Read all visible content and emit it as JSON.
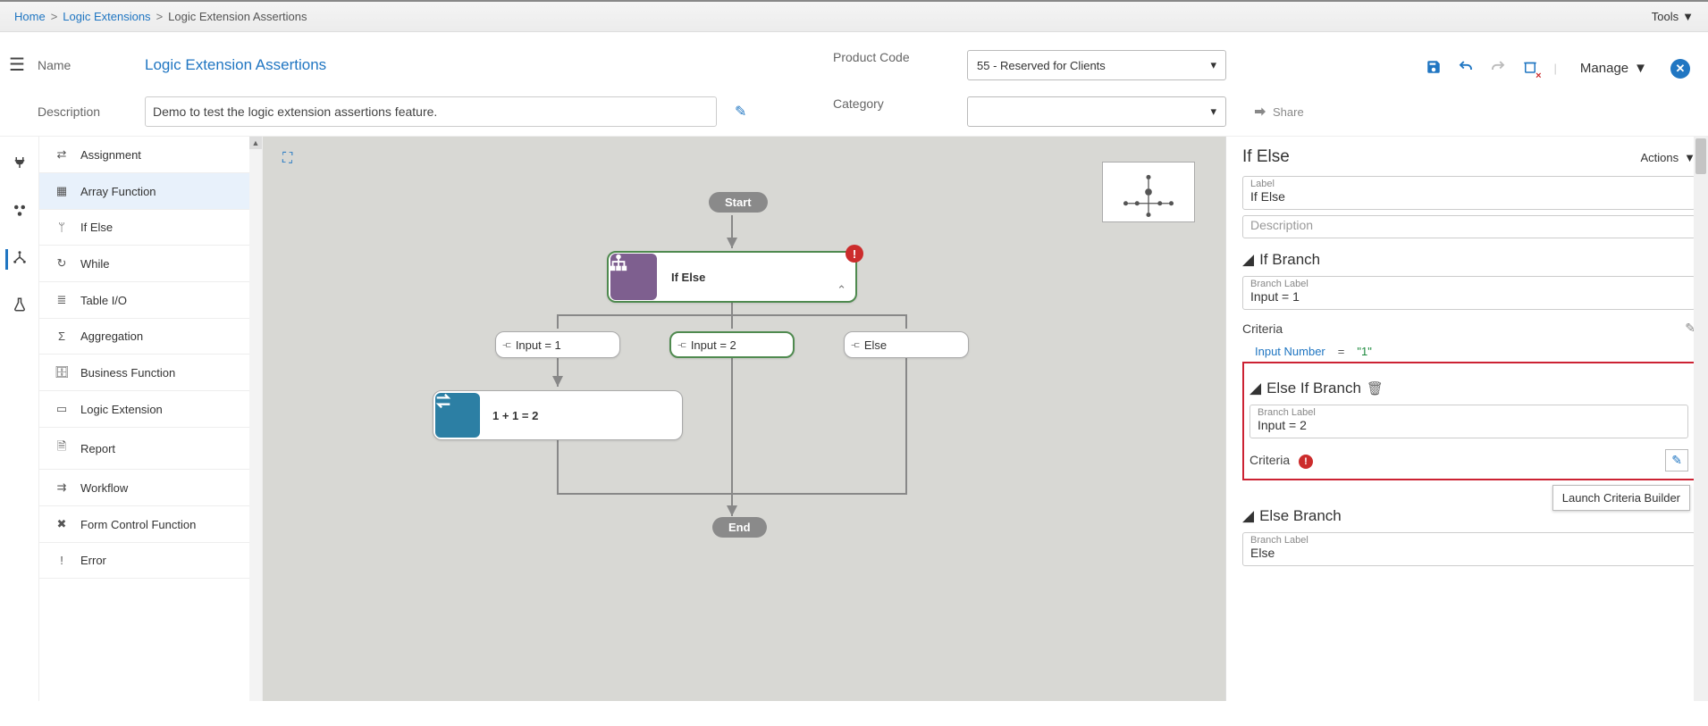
{
  "breadcrumbs": {
    "home": "Home",
    "logic_ext": "Logic Extensions",
    "current": "Logic Extension Assertions"
  },
  "tools_label": "Tools",
  "toolbar": {
    "manage_label": "Manage"
  },
  "form": {
    "name_label": "Name",
    "name_value": "Logic Extension Assertions",
    "desc_label": "Description",
    "desc_value": "Demo to test the logic extension assertions feature.",
    "product_code_label": "Product Code",
    "product_code_value": "55 - Reserved for Clients",
    "category_label": "Category",
    "category_value": "",
    "share_label": "Share"
  },
  "components": [
    {
      "icon": "swap",
      "label": "Assignment"
    },
    {
      "icon": "grid",
      "label": "Array Function",
      "selected": true
    },
    {
      "icon": "tree",
      "label": "If Else"
    },
    {
      "icon": "loop",
      "label": "While"
    },
    {
      "icon": "db",
      "label": "Table I/O"
    },
    {
      "icon": "sigma",
      "label": "Aggregation"
    },
    {
      "icon": "briefcase",
      "label": "Business Function"
    },
    {
      "icon": "wireframe",
      "label": "Logic Extension"
    },
    {
      "icon": "doc",
      "label": "Report"
    },
    {
      "icon": "flow",
      "label": "Workflow"
    },
    {
      "icon": "wrench",
      "label": "Form Control Function"
    },
    {
      "icon": "excl",
      "label": "Error"
    }
  ],
  "canvas": {
    "start": "Start",
    "end": "End",
    "ifelse_label": "If Else",
    "branch1": "Input = 1",
    "branch2": "Input = 2",
    "branch3": "Else",
    "assign1": "1 + 1 = 2"
  },
  "props": {
    "title": "If Else",
    "actions_label": "Actions",
    "label_field": "Label",
    "label_value": "If Else",
    "desc_placeholder": "Description",
    "if_branch_title": "If Branch",
    "branch_label_field": "Branch Label",
    "if_branch_value": "Input = 1",
    "criteria_label": "Criteria",
    "criteria_lhs": "Input Number",
    "criteria_op": "=",
    "criteria_rhs": "\"1\"",
    "elseif_title": "Else If Branch",
    "elseif_value": "Input = 2",
    "else_title": "Else Branch",
    "else_value": "Else",
    "tooltip": "Launch Criteria Builder"
  }
}
